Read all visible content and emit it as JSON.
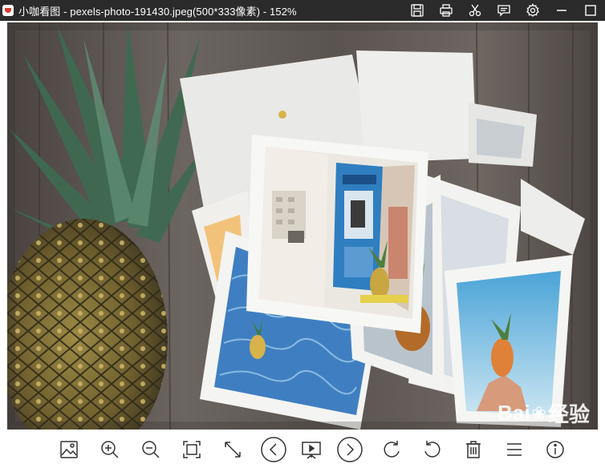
{
  "window": {
    "title": "小咖看图 - pexels-photo-191430.jpeg(500*333像素) - 152%",
    "title_bar_icons": [
      "save-icon",
      "print-icon",
      "cut-icon",
      "comment-icon",
      "gear-icon",
      "minimize-icon",
      "maximize-icon"
    ]
  },
  "image": {
    "alt": "pexels-photo-191430.jpeg"
  },
  "watermark": {
    "text_left": "Bai",
    "paw": "❀",
    "text_right": "经验",
    "sub": ""
  },
  "toolbar": {
    "icons": [
      "picture-icon",
      "zoom-in-icon",
      "zoom-out-icon",
      "fit-window-icon",
      "fullscreen-icon",
      "previous-icon",
      "slideshow-icon",
      "next-icon",
      "rotate-clockwise-icon",
      "rotate-counterclockwise-icon",
      "delete-icon",
      "menu-icon",
      "info-icon"
    ]
  },
  "colors": {
    "titlebar_bg": "#2b2b2b",
    "titlebar_fg": "#ffffff",
    "app_logo_red": "#d8392b",
    "toolbar_icon": "#333333"
  }
}
